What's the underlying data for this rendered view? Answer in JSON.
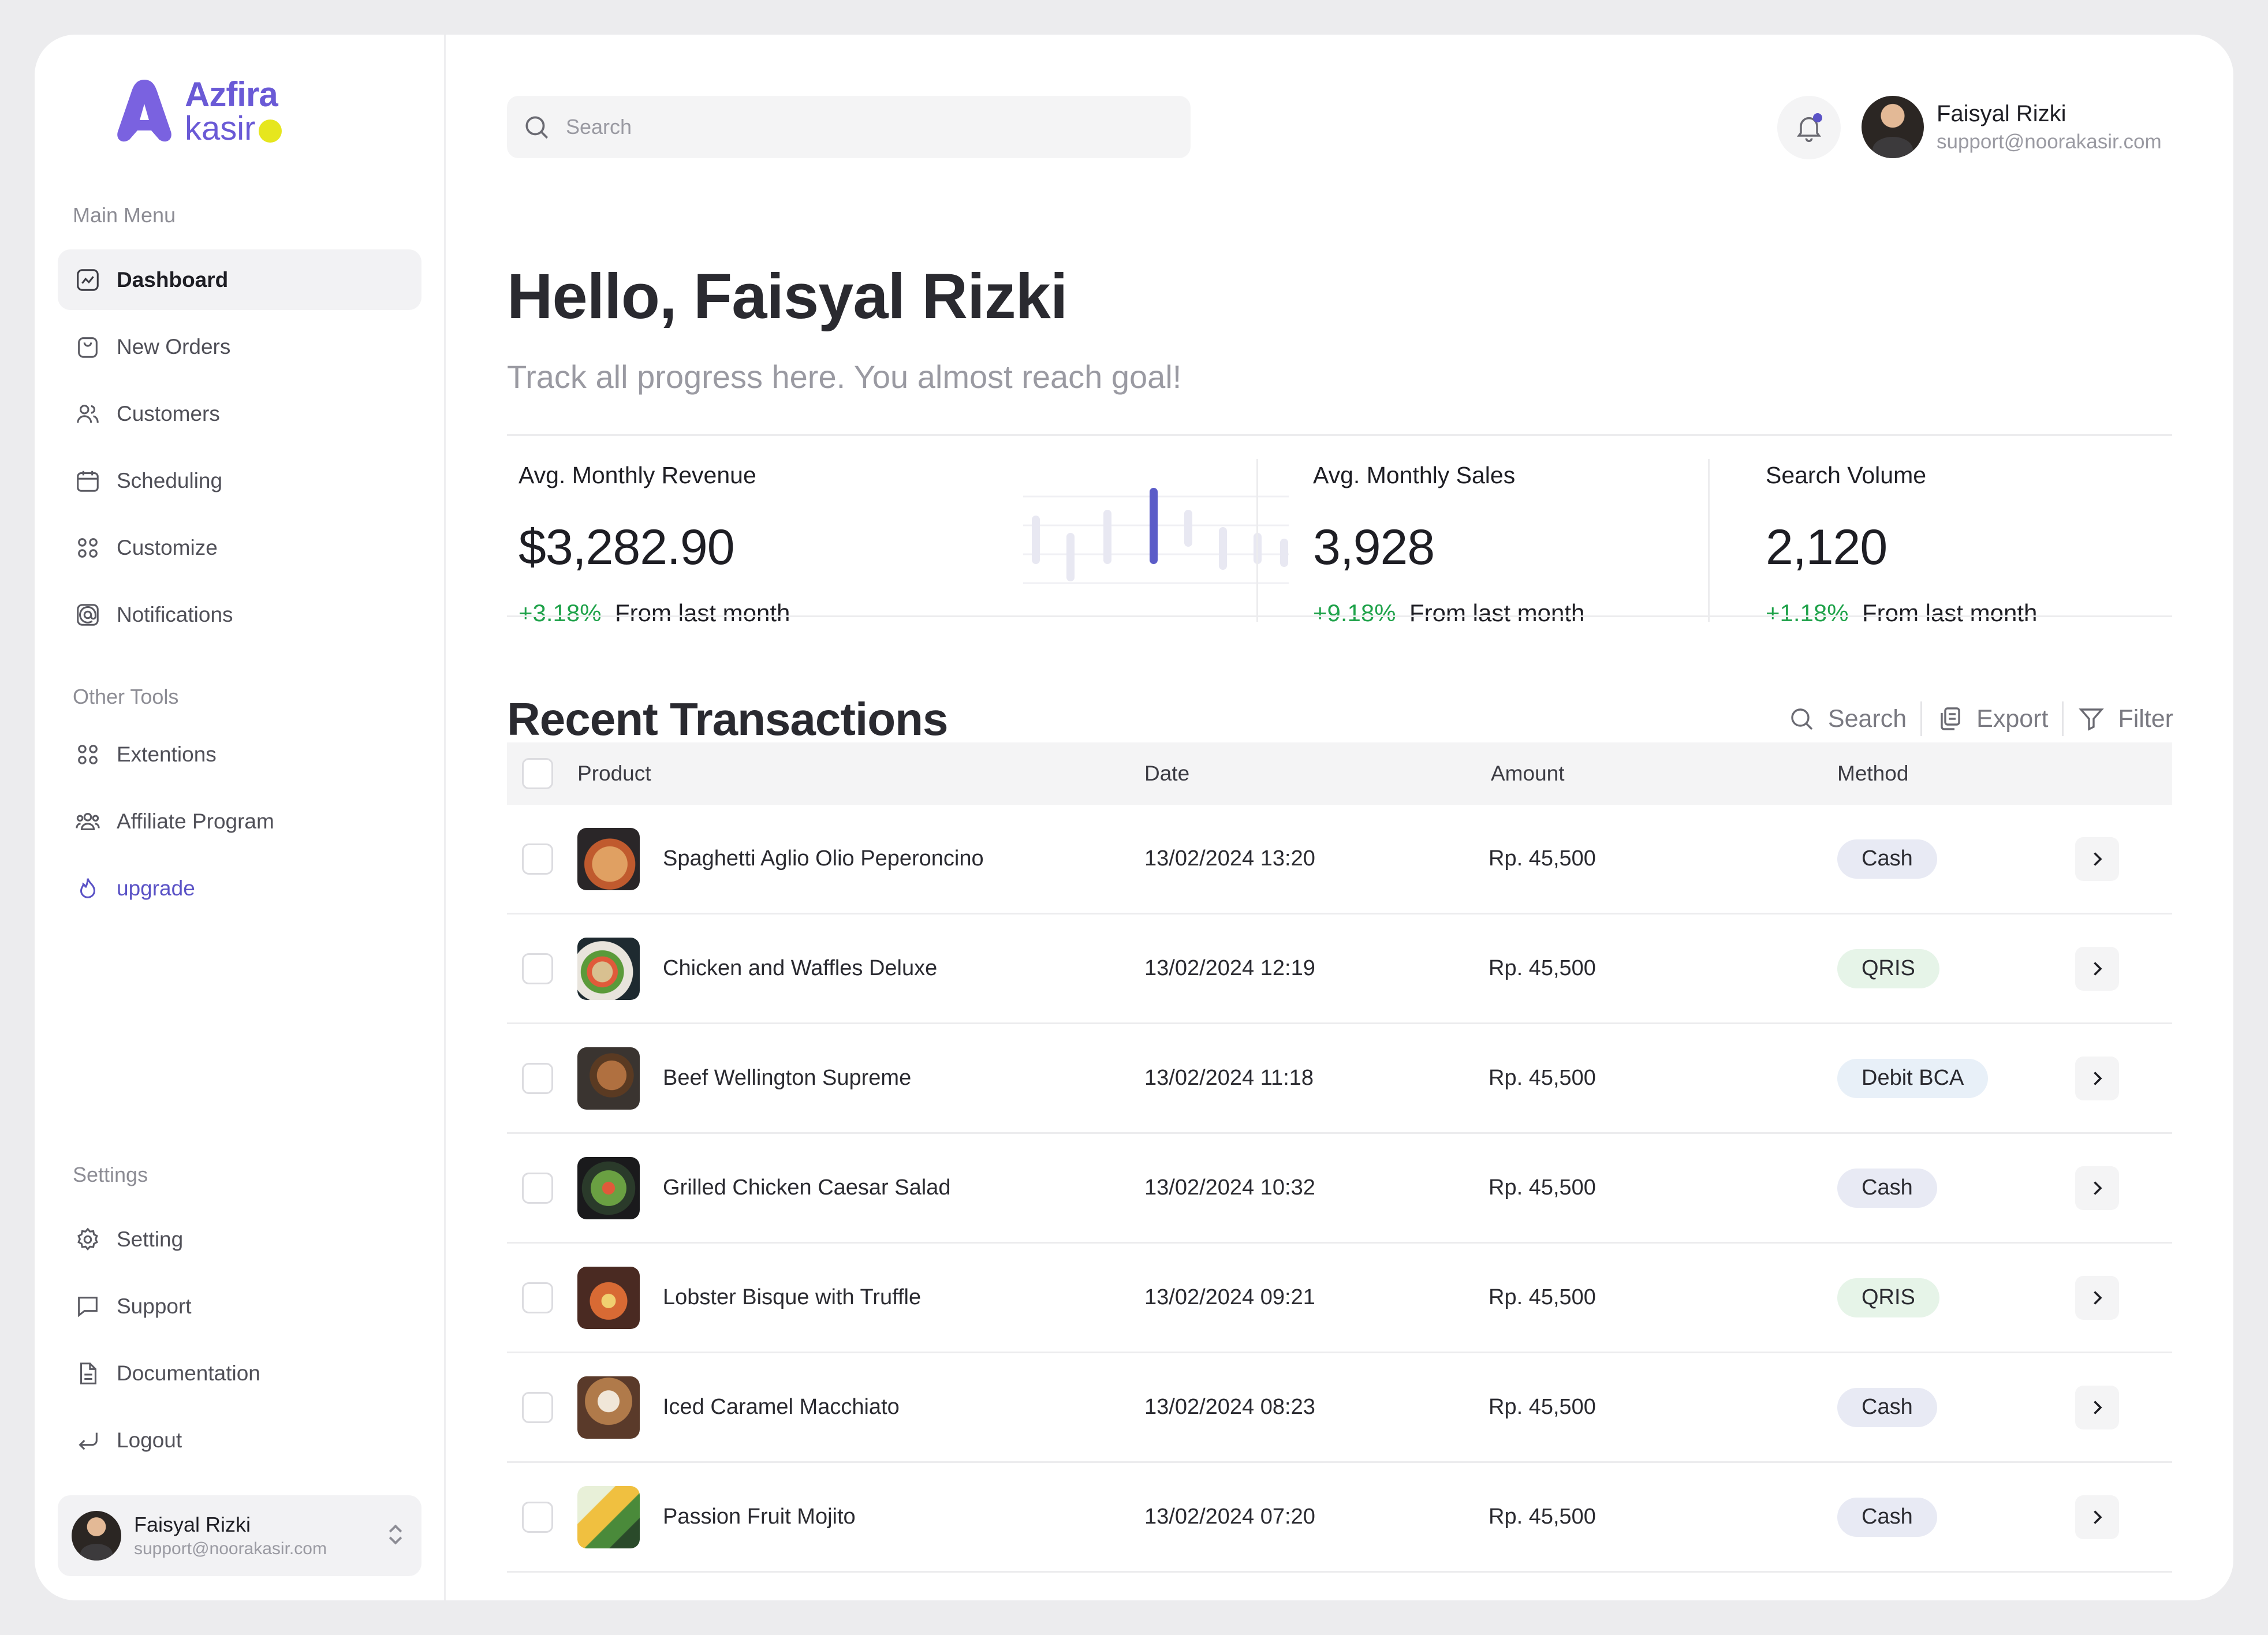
{
  "app": {
    "logo_line1": "Azfira",
    "logo_line2": "kasir",
    "brand_color": "#6a5ad6",
    "accent_dot_color": "#e6e61e"
  },
  "sidebar": {
    "main_menu_title": "Main Menu",
    "main_items": [
      {
        "label": "Dashboard",
        "icon": "chart-icon",
        "active": true
      },
      {
        "label": "New Orders",
        "icon": "bag-icon"
      },
      {
        "label": "Customers",
        "icon": "users-icon"
      },
      {
        "label": "Scheduling",
        "icon": "calendar-icon"
      },
      {
        "label": "Customize",
        "icon": "grid-icon"
      },
      {
        "label": "Notifications",
        "icon": "at-icon"
      }
    ],
    "other_tools_title": "Other Tools",
    "other_items": [
      {
        "label": "Extentions",
        "icon": "grid-icon"
      },
      {
        "label": "Affiliate Program",
        "icon": "group-icon"
      },
      {
        "label": "upgrade",
        "icon": "flame-icon"
      }
    ],
    "settings_title": "Settings",
    "settings_items": [
      {
        "label": "Setting",
        "icon": "gear-icon"
      },
      {
        "label": "Support",
        "icon": "chat-icon"
      },
      {
        "label": "Documentation",
        "icon": "document-icon"
      },
      {
        "label": "Logout",
        "icon": "logout-icon"
      }
    ],
    "user": {
      "name": "Faisyal Rizki",
      "email": "support@noorakasir.com"
    }
  },
  "header": {
    "search_placeholder": "Search",
    "user": {
      "name": "Faisyal Rizki",
      "email": "support@noorakasir.com"
    }
  },
  "greeting": {
    "title": "Hello, Faisyal Rizki",
    "subtitle": "Track all progress here. You almost reach goal!"
  },
  "stats": [
    {
      "title": "Avg. Monthly Revenue",
      "value": "$3,282.90",
      "change": "+3.18%",
      "suffix": "From last month"
    },
    {
      "title": "Avg. Monthly Sales",
      "value": "3,928",
      "change": "+9.18%",
      "suffix": "From last month"
    },
    {
      "title": "Search Volume",
      "value": "2,120",
      "change": "+1.18%",
      "suffix": "From last month"
    }
  ],
  "transactions": {
    "title": "Recent Transactions",
    "tools": {
      "search": "Search",
      "export": "Export",
      "filter": "Filter"
    },
    "columns": {
      "product": "Product",
      "date": "Date",
      "amount": "Amount",
      "method": "Method"
    },
    "rows": [
      {
        "product": "Spaghetti Aglio Olio Peperoncino",
        "date": "13/02/2024 13:20",
        "amount": "Rp. 45,500",
        "method": "Cash"
      },
      {
        "product": "Chicken and Waffles Deluxe",
        "date": "13/02/2024 12:19",
        "amount": "Rp. 45,500",
        "method": "QRIS"
      },
      {
        "product": "Beef Wellington Supreme",
        "date": "13/02/2024 11:18",
        "amount": "Rp. 45,500",
        "method": "Debit BCA"
      },
      {
        "product": "Grilled Chicken Caesar Salad",
        "date": "13/02/2024 10:32",
        "amount": "Rp. 45,500",
        "method": "Cash"
      },
      {
        "product": "Lobster Bisque with Truffle",
        "date": "13/02/2024 09:21",
        "amount": "Rp. 45,500",
        "method": "QRIS"
      },
      {
        "product": "Iced Caramel Macchiato",
        "date": "13/02/2024 08:23",
        "amount": "Rp. 45,500",
        "method": "Cash"
      },
      {
        "product": "Passion Fruit Mojito",
        "date": "13/02/2024 07:20",
        "amount": "Rp. 45,500",
        "method": "Cash"
      }
    ]
  }
}
